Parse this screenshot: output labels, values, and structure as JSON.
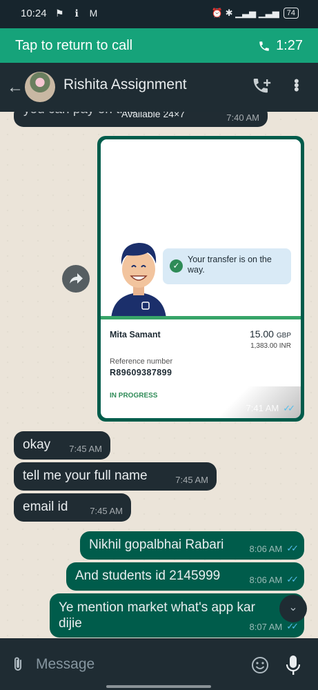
{
  "status_bar": {
    "time": "10:24",
    "left_icons": "⚑ ℹ M",
    "right_icons": "⏰ ✱ ▁▃▅ ▁▃▅",
    "battery": "74"
  },
  "call_banner": {
    "label": "Tap to return to call",
    "duration": "1:27"
  },
  "header": {
    "title": "Rishita Assignment"
  },
  "messages": {
    "partial_top": {
      "text": "you can pay on this",
      "overlay": "Available 24×7",
      "time": "7:40 AM"
    },
    "transfer_card": {
      "bubble_text": "Your transfer is on the way.",
      "payee": "Mita Samant",
      "amount": "15.00",
      "currency": "GBP",
      "amount_inr": "1,383.00 INR",
      "ref_label": "Reference number",
      "ref_value": "R89609387899",
      "status": "IN PROGRESS",
      "time": "7:41 AM"
    },
    "m1": {
      "text": "okay",
      "time": "7:45 AM"
    },
    "m2": {
      "text": "tell me your full name",
      "time": "7:45 AM"
    },
    "m3": {
      "text": "email id",
      "time": "7:45 AM"
    },
    "m4": {
      "text": "Nikhil gopalbhai Rabari",
      "time": "8:06 AM"
    },
    "m5": {
      "text": "And students id 2145999",
      "time": "8:06 AM"
    },
    "m6": {
      "text": "Ye mention market what's app kar dijie",
      "time": "8:07 AM"
    }
  },
  "composer": {
    "placeholder": "Message"
  },
  "colors": {
    "banner": "#16a37a",
    "header": "#1f2c33",
    "incoming": "#202c33",
    "outgoing": "#005c4b",
    "read_ticks": "#53bdeb"
  }
}
